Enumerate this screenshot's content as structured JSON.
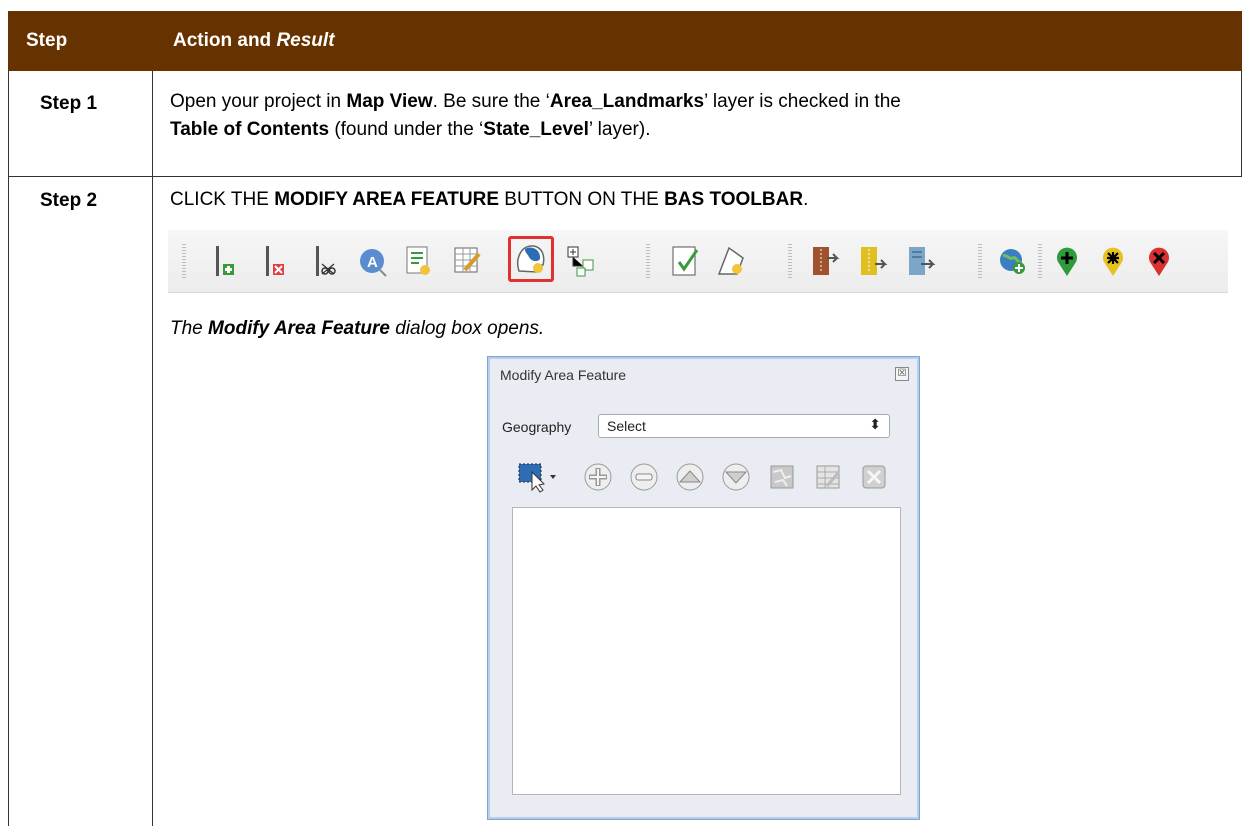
{
  "table": {
    "header_step": "Step",
    "header_action_prefix": "Action and ",
    "header_action_emph": "Result"
  },
  "step1": {
    "label": "Step 1",
    "t1": "Open your project in ",
    "b1": "Map View",
    "t2": ". Be sure the ‘",
    "b2": "Area_Landmarks",
    "t3": "’ layer is checked in the",
    "b3": "Table of Contents",
    "t4": " (found under the ‘",
    "b4": "State_Level",
    "t5": "’ layer)."
  },
  "step2": {
    "label": "Step 2",
    "t1": "CLICK THE ",
    "b1": "MODIFY AREA FEATURE",
    "t2": " BUTTON ON THE ",
    "b2": "BAS TOOLBAR",
    "t3": ".",
    "result_t1": "The ",
    "result_b1": "Modify Area Feature",
    "result_t2": " dialog box opens."
  },
  "dialog": {
    "title": "Modify Area Feature",
    "close_glyph": "☒",
    "geography_label": "Geography",
    "geography_value": "Select",
    "select_arrow": "⬍"
  },
  "colors": {
    "header_bg": "#663300",
    "highlight": "#e03030"
  }
}
